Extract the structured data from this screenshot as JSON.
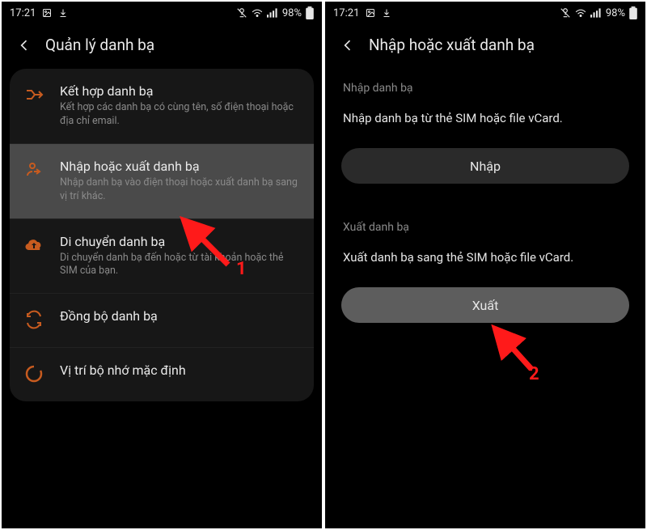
{
  "status": {
    "time": "17:21",
    "battery": "98%"
  },
  "left": {
    "title": "Quản lý danh bạ",
    "items": [
      {
        "title": "Kết hợp danh bạ",
        "sub": "Kết hợp các danh bạ có cùng tên, số điện thoại hoặc địa chỉ email."
      },
      {
        "title": "Nhập hoặc xuất danh bạ",
        "sub": "Nhập danh bạ vào điện thoại hoặc xuất danh bạ sang vị trí khác."
      },
      {
        "title": "Di chuyển danh bạ",
        "sub": "Di chuyển danh bạ đến hoặc từ tài khoản hoặc thẻ SIM của bạn."
      },
      {
        "title": "Đồng bộ danh bạ",
        "sub": ""
      },
      {
        "title": "Vị trí bộ nhớ mặc định",
        "sub": ""
      }
    ]
  },
  "right": {
    "title": "Nhập hoặc xuất danh bạ",
    "import": {
      "label": "Nhập danh bạ",
      "text": "Nhập danh bạ từ thẻ SIM hoặc file vCard.",
      "button": "Nhập"
    },
    "export": {
      "label": "Xuất danh bạ",
      "text": "Xuất danh bạ sang thẻ SIM hoặc file vCard.",
      "button": "Xuất"
    }
  },
  "anno": {
    "one": "1",
    "two": "2"
  }
}
